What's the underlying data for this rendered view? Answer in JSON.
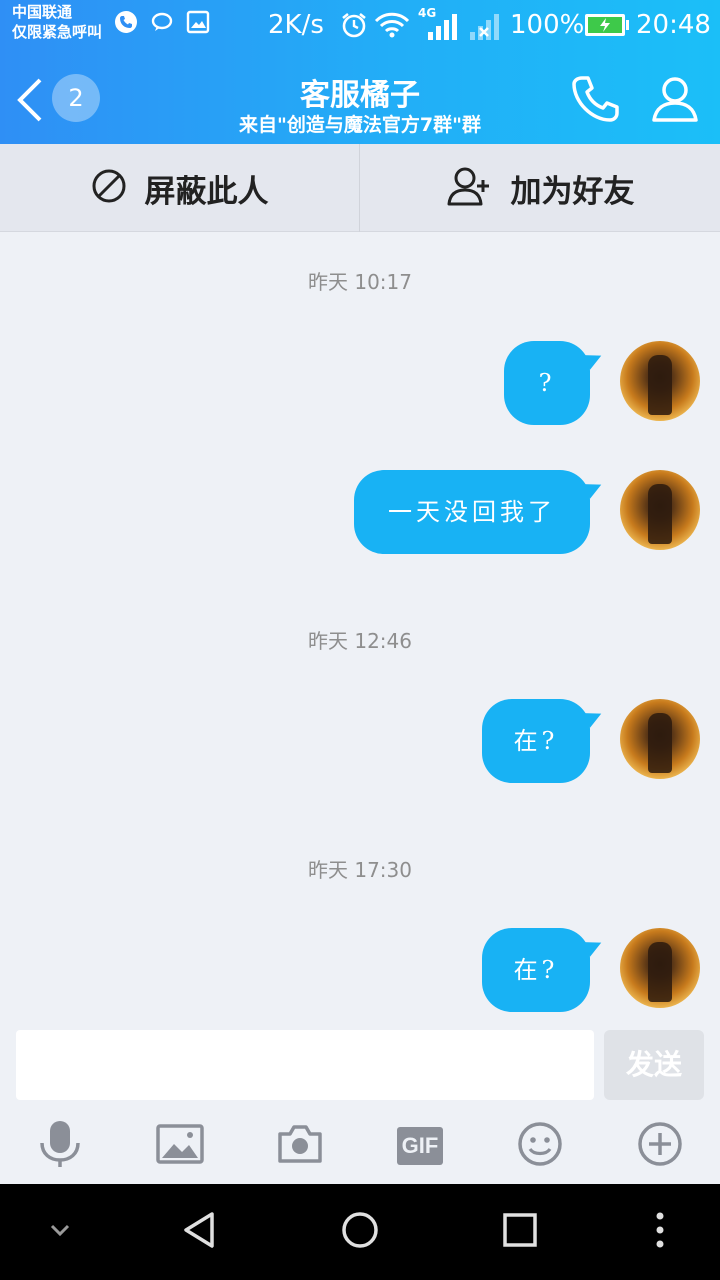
{
  "status_bar": {
    "carrier_line1": "中国联通",
    "carrier_line2": "仅限紧急呼叫",
    "speed": "2K/s",
    "network": "4G",
    "battery": "100%",
    "time": "20:48"
  },
  "header": {
    "back_badge": "2",
    "title": "客服橘子",
    "subtitle": "来自\"创造与魔法官方7群\"群"
  },
  "actions": {
    "block_label": "屏蔽此人",
    "add_friend_label": "加为好友"
  },
  "messages": [
    {
      "timestamp": "昨天 10:17"
    },
    {
      "text": "?"
    },
    {
      "text": "一天没回我了"
    },
    {
      "timestamp": "昨天 12:46"
    },
    {
      "text": "在?"
    },
    {
      "timestamp": "昨天 17:30"
    },
    {
      "text": "在?"
    }
  ],
  "input": {
    "value": "",
    "send_label": "发送"
  },
  "toolbar": {
    "icons": [
      "microphone-icon",
      "image-icon",
      "camera-icon",
      "gif-icon",
      "emoji-icon",
      "plus-icon"
    ],
    "gif_label": "GIF"
  },
  "navbar": {
    "icons": [
      "chevron-down-icon",
      "back-triangle-icon",
      "home-circle-icon",
      "recents-square-icon",
      "more-dots-icon"
    ]
  },
  "colors": {
    "header_start": "#2f8ff5",
    "header_end": "#1bbff8",
    "bubble": "#18b2f4",
    "background": "#eef1f6"
  }
}
